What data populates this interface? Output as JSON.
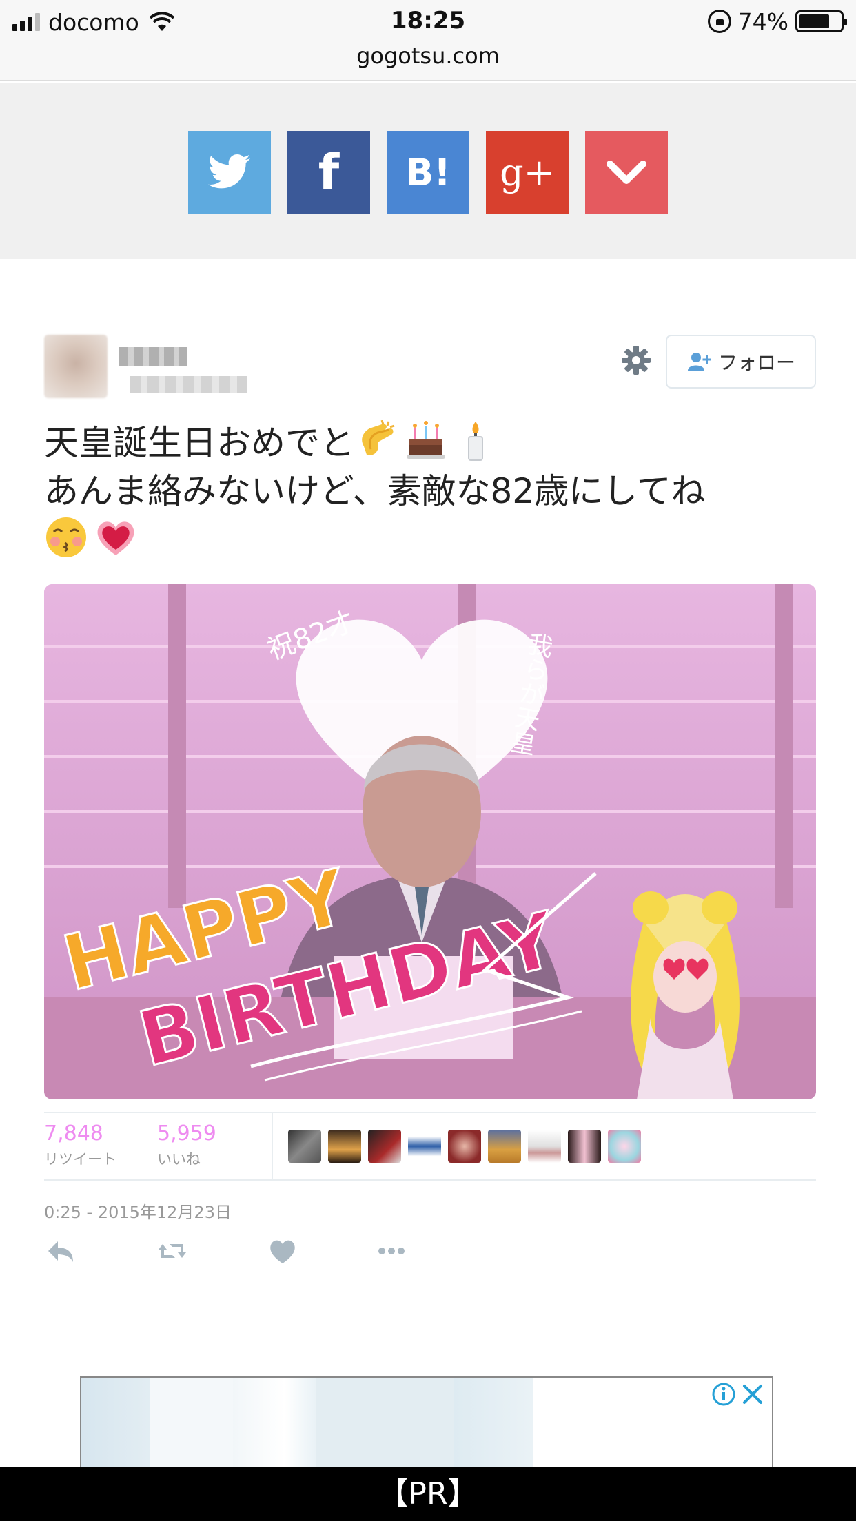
{
  "status_bar": {
    "carrier": "docomo",
    "time": "18:25",
    "battery_percent": "74%",
    "battery_level": 0.74,
    "url": "gogotsu.com"
  },
  "share_buttons": [
    {
      "name": "twitter",
      "icon": "twitter-bird-icon",
      "color": "#5eaadf"
    },
    {
      "name": "facebook",
      "label": "f",
      "color": "#3b5998"
    },
    {
      "name": "hatena-bookmark",
      "label": "B!",
      "color": "#4a86d3"
    },
    {
      "name": "google-plus",
      "label": "g+",
      "color": "#d8402e"
    },
    {
      "name": "pocket",
      "icon": "chevron-down-icon",
      "color": "#e55a5f"
    }
  ],
  "tweet": {
    "follow_label": "フォロー",
    "text_line1": "天皇誕生日おめでと",
    "text_line2": "あんま絡みないけど、素敵な82歳にしてね",
    "emojis_line1": [
      "clapping-hands-emoji",
      "birthday-cake-emoji",
      "candle-emoji"
    ],
    "emojis_line3": [
      "kissing-face-emoji",
      "heart-emoji"
    ],
    "media": {
      "handwritten_left": "祝82才",
      "handwritten_right": "我らが天皇",
      "banner_line1": "HAPPY",
      "banner_line2": "BIRTHDAY"
    },
    "retweets": "7,848",
    "retweets_label": "リツイート",
    "likes": "5,959",
    "likes_label": "いいね",
    "liker_count": 9,
    "timestamp": "0:25 - 2015年12月23日"
  },
  "ad": {
    "pr_label": "【PR】"
  }
}
